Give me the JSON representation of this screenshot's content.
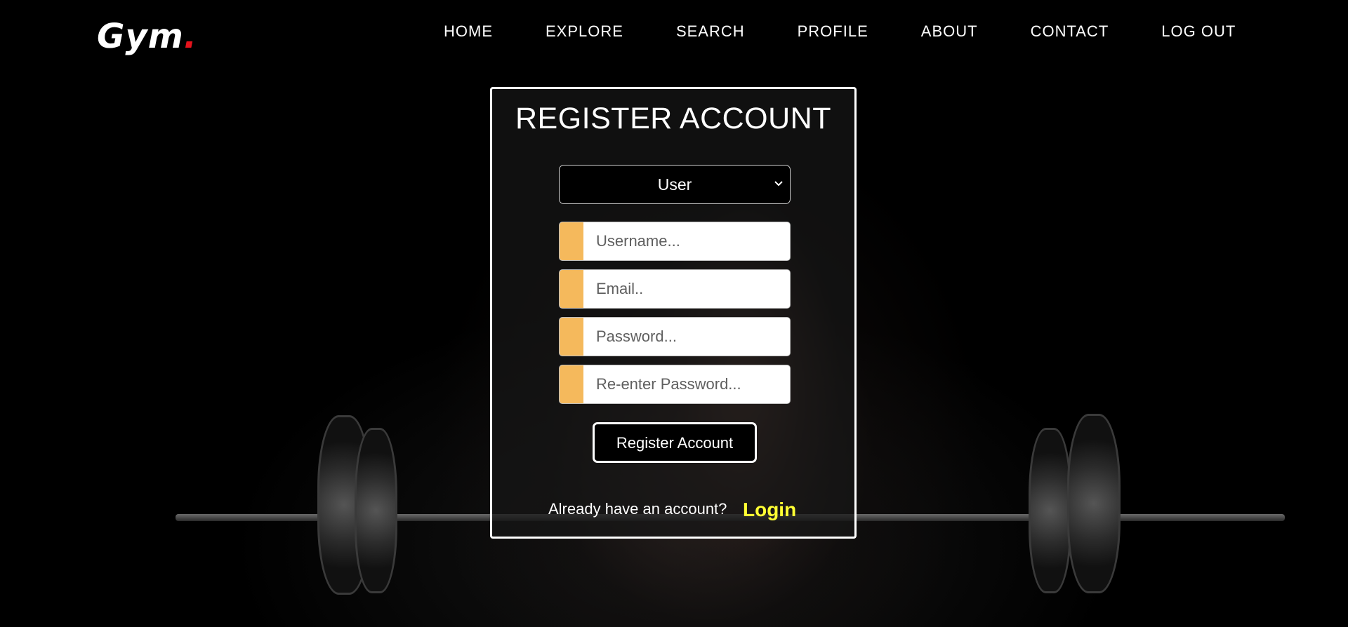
{
  "brand": {
    "logo_text": "Gym",
    "logo_dot": ".",
    "dot_color": "#e5131c"
  },
  "nav": {
    "items": [
      "HOME",
      "EXPLORE",
      "SEARCH",
      "PROFILE",
      "ABOUT",
      "CONTACT",
      "LOG OUT"
    ]
  },
  "register": {
    "title": "REGISTER ACCOUNT",
    "role_select": {
      "selected": "User",
      "icon": "chevron-down-icon"
    },
    "fields": {
      "username_placeholder": "Username...",
      "email_placeholder": "Email..",
      "password_placeholder": "Password...",
      "reenter_placeholder": "Re-enter Password..."
    },
    "submit_label": "Register Account",
    "already_text": "Already have an account?",
    "login_label": "Login"
  },
  "colors": {
    "accent": "#f5b95c",
    "link": "#ffff33",
    "background": "#000000"
  }
}
